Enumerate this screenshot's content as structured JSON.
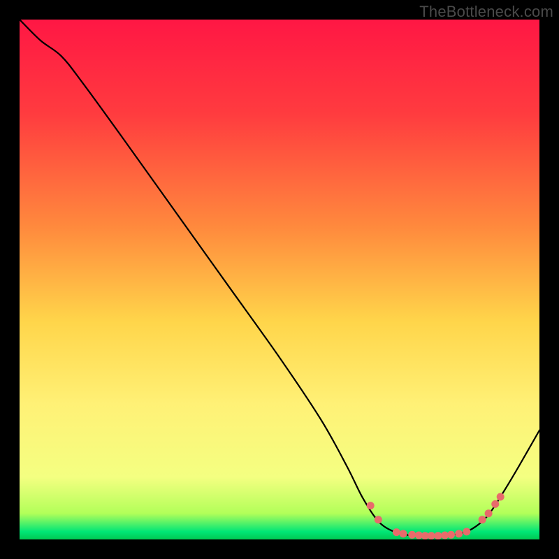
{
  "watermark": "TheBottleneck.com",
  "chart_data": {
    "type": "line",
    "title": "",
    "xlabel": "",
    "ylabel": "",
    "xlim": [
      0,
      100
    ],
    "ylim": [
      0,
      100
    ],
    "gradient_stops": [
      {
        "offset": 0.0,
        "color": "#ff1744"
      },
      {
        "offset": 0.18,
        "color": "#ff3b3f"
      },
      {
        "offset": 0.4,
        "color": "#ff8a3d"
      },
      {
        "offset": 0.58,
        "color": "#ffd54a"
      },
      {
        "offset": 0.74,
        "color": "#fff176"
      },
      {
        "offset": 0.88,
        "color": "#f4ff81"
      },
      {
        "offset": 0.95,
        "color": "#b2ff59"
      },
      {
        "offset": 0.985,
        "color": "#00e676"
      },
      {
        "offset": 1.0,
        "color": "#00c853"
      }
    ],
    "curve": [
      {
        "x": 0,
        "y": 100
      },
      {
        "x": 4,
        "y": 96
      },
      {
        "x": 8,
        "y": 93
      },
      {
        "x": 12,
        "y": 88
      },
      {
        "x": 20,
        "y": 77
      },
      {
        "x": 30,
        "y": 63
      },
      {
        "x": 40,
        "y": 49
      },
      {
        "x": 50,
        "y": 35
      },
      {
        "x": 58,
        "y": 23
      },
      {
        "x": 63,
        "y": 14
      },
      {
        "x": 66,
        "y": 8
      },
      {
        "x": 69,
        "y": 3.5
      },
      {
        "x": 72,
        "y": 1.5
      },
      {
        "x": 75,
        "y": 0.8
      },
      {
        "x": 78,
        "y": 0.6
      },
      {
        "x": 81,
        "y": 0.7
      },
      {
        "x": 84,
        "y": 1.0
      },
      {
        "x": 87,
        "y": 2.0
      },
      {
        "x": 90,
        "y": 4.5
      },
      {
        "x": 93,
        "y": 9.0
      },
      {
        "x": 96,
        "y": 14.0
      },
      {
        "x": 100,
        "y": 21.0
      }
    ],
    "markers": [
      {
        "x": 67.5,
        "y": 6.5
      },
      {
        "x": 69.0,
        "y": 3.8
      },
      {
        "x": 72.5,
        "y": 1.4
      },
      {
        "x": 73.8,
        "y": 1.1
      },
      {
        "x": 75.5,
        "y": 0.9
      },
      {
        "x": 76.8,
        "y": 0.8
      },
      {
        "x": 78.0,
        "y": 0.7
      },
      {
        "x": 79.2,
        "y": 0.7
      },
      {
        "x": 80.5,
        "y": 0.7
      },
      {
        "x": 81.8,
        "y": 0.8
      },
      {
        "x": 83.0,
        "y": 0.9
      },
      {
        "x": 84.5,
        "y": 1.1
      },
      {
        "x": 86.0,
        "y": 1.5
      },
      {
        "x": 89.0,
        "y": 3.8
      },
      {
        "x": 90.2,
        "y": 5.0
      },
      {
        "x": 91.5,
        "y": 6.8
      },
      {
        "x": 92.5,
        "y": 8.2
      }
    ],
    "marker_color": "#e86b6b",
    "curve_color": "#000000"
  }
}
